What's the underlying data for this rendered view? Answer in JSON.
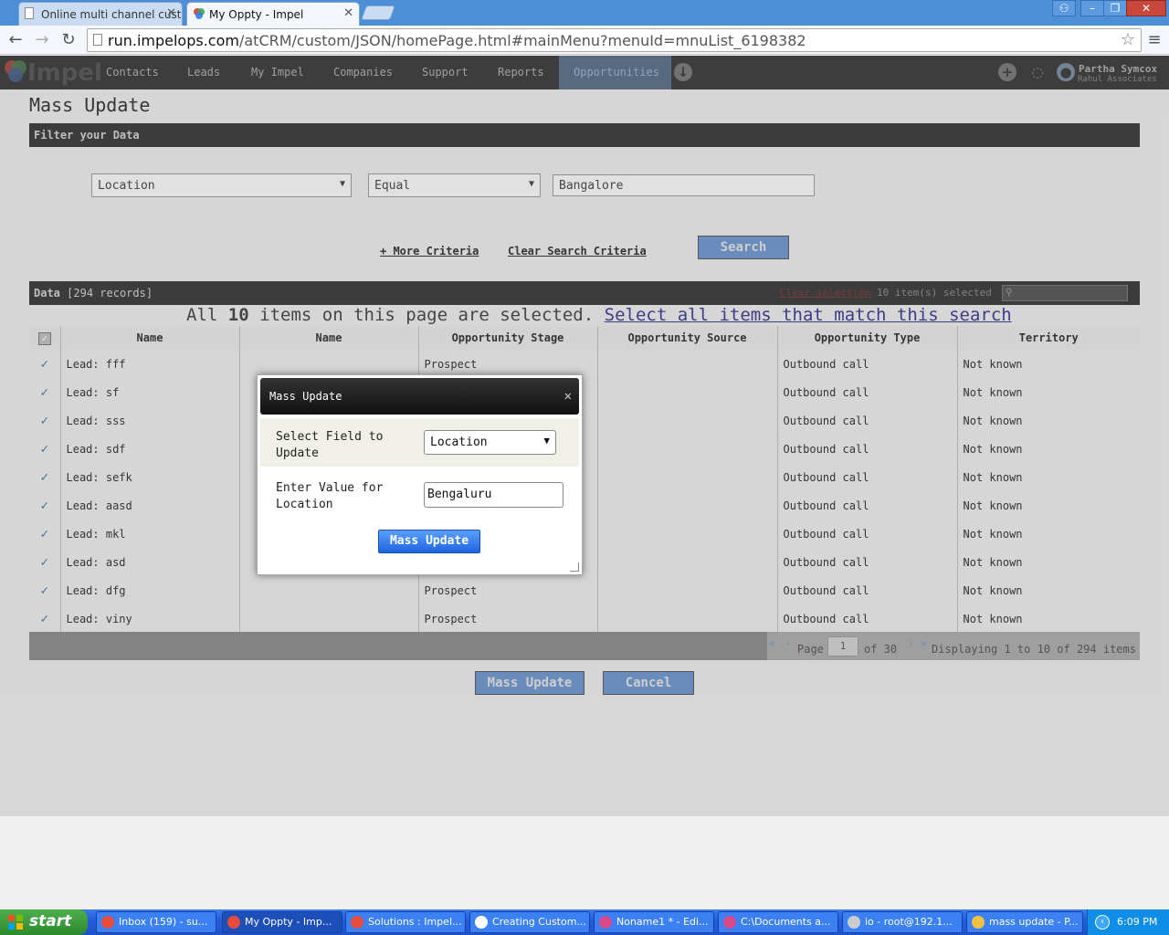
{
  "browser": {
    "tabs": [
      {
        "label": "Online multi channel custome",
        "active": false
      },
      {
        "label": "My Oppty - Impel",
        "active": true
      }
    ],
    "url_host": "run.impelops.com",
    "url_path": "/atCRM/custom/JSON/homePage.html#mainMenu?menuId=mnuList_6198382"
  },
  "app": {
    "logo_text": "Impel",
    "menu": [
      "Contacts",
      "Leads",
      "My Impel",
      "Companies",
      "Support",
      "Reports",
      "Opportunities"
    ],
    "active_menu": "Opportunities",
    "user_name": "Partha Symcox",
    "user_org": "Rahul Associates"
  },
  "page": {
    "title": "Mass Update",
    "filter_header": "Filter your Data",
    "filter_field": "Location",
    "filter_operator": "Equal",
    "filter_value": "Bangalore",
    "more_criteria": "+ More Criteria",
    "clear_criteria": "Clear Search Criteria",
    "search_button": "Search",
    "data_header": "Data",
    "data_count": "[294 records]",
    "clear_selection": "Clear selection",
    "items_selected": "10 item(s) selected",
    "sel_msg_prefix": "All",
    "sel_msg_count": "10",
    "sel_msg_suffix": "items on this page are selected.",
    "sel_msg_link": "Select all items that match this search",
    "columns": [
      "Name",
      "Name",
      "Opportunity Stage",
      "Opportunity Source",
      "Opportunity Type",
      "Territory"
    ],
    "rows": [
      {
        "name": "Lead: fff",
        "stage": "Prospect",
        "type": "Outbound call",
        "territory": "Not known"
      },
      {
        "name": "Lead: sf",
        "stage": "",
        "type": "Outbound call",
        "territory": "Not known"
      },
      {
        "name": "Lead: sss",
        "stage": "",
        "type": "Outbound call",
        "territory": "Not known"
      },
      {
        "name": "Lead: sdf",
        "stage": "",
        "type": "Outbound call",
        "territory": "Not known"
      },
      {
        "name": "Lead: sefk",
        "stage": "",
        "type": "Outbound call",
        "territory": "Not known"
      },
      {
        "name": "Lead: aasd",
        "stage": "",
        "type": "Outbound call",
        "territory": "Not known"
      },
      {
        "name": "Lead: mkl",
        "stage": "",
        "type": "Outbound call",
        "territory": "Not known"
      },
      {
        "name": "Lead: asd",
        "stage": "",
        "type": "Outbound call",
        "territory": "Not known"
      },
      {
        "name": "Lead: dfg",
        "stage": "Prospect",
        "type": "Outbound call",
        "territory": "Not known"
      },
      {
        "name": "Lead: viny",
        "stage": "Prospect",
        "type": "Outbound call",
        "territory": "Not known"
      }
    ],
    "pager_page_label": "Page",
    "pager_page": "1",
    "pager_of": "of 30",
    "pager_display": "Displaying 1 to 10 of 294 items",
    "mass_update_button": "Mass Update",
    "cancel_button": "Cancel"
  },
  "dialog": {
    "title": "Mass Update",
    "field_label_1": "Select Field to",
    "field_label_2": "Update",
    "field_value": "Location",
    "value_label_1": "Enter Value for",
    "value_label_2": "Location",
    "value": "Bengaluru",
    "button": "Mass Update"
  },
  "taskbar": {
    "start": "start",
    "tasks": [
      {
        "label": "Inbox (159) - su...",
        "active": false,
        "color": "#e84c3d"
      },
      {
        "label": "My Oppty - Imp...",
        "active": true,
        "color": "#e84c3d"
      },
      {
        "label": "Solutions : Impel...",
        "active": false,
        "color": "#e84c3d"
      },
      {
        "label": "Creating Custom...",
        "active": false,
        "color": "#ffffff"
      },
      {
        "label": "Noname1 * - Edi...",
        "active": false,
        "color": "#d64a8a"
      },
      {
        "label": "C:\\Documents a...",
        "active": false,
        "color": "#d64a8a"
      },
      {
        "label": "io - root@192.1...",
        "active": false,
        "color": "#cccccc"
      },
      {
        "label": "mass update - P...",
        "active": false,
        "color": "#f0c040"
      }
    ],
    "clock": "6:09 PM"
  }
}
